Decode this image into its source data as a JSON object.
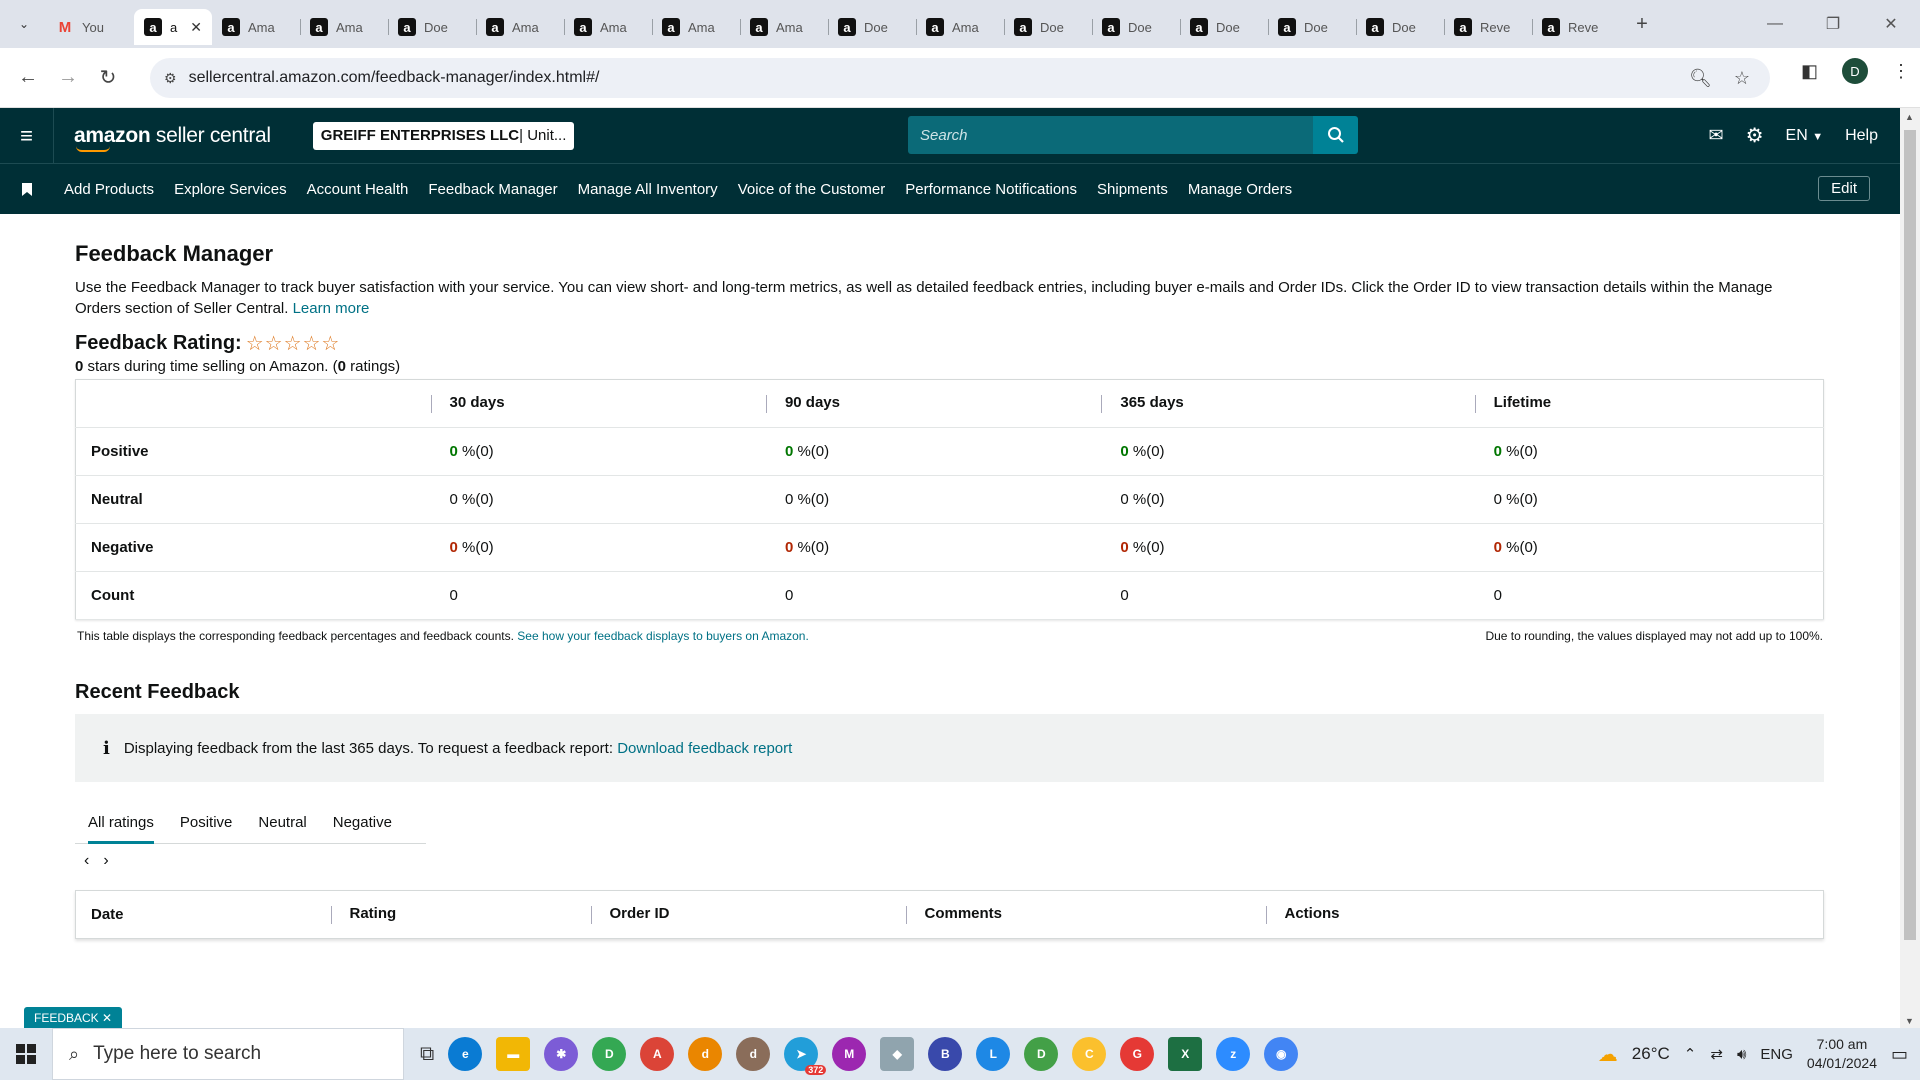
{
  "browser": {
    "tabs": [
      {
        "label": "You",
        "icon": "gmail-icon"
      },
      {
        "label": "a",
        "icon": "amazon-icon",
        "active": true
      },
      {
        "label": "Ama",
        "icon": "amazon-icon"
      },
      {
        "label": "Ama",
        "icon": "amazon-icon"
      },
      {
        "label": "Doe",
        "icon": "amazon-icon"
      },
      {
        "label": "Ama",
        "icon": "amazon-icon"
      },
      {
        "label": "Ama",
        "icon": "amazon-icon"
      },
      {
        "label": "Ama",
        "icon": "amazon-icon"
      },
      {
        "label": "Ama",
        "icon": "amazon-icon"
      },
      {
        "label": "Doe",
        "icon": "amazon-icon"
      },
      {
        "label": "Ama",
        "icon": "amazon-icon"
      },
      {
        "label": "Doe",
        "icon": "amazon-icon"
      },
      {
        "label": "Doe",
        "icon": "amazon-icon"
      },
      {
        "label": "Doe",
        "icon": "amazon-icon"
      },
      {
        "label": "Doe",
        "icon": "amazon-icon"
      },
      {
        "label": "Doe",
        "icon": "amazon-icon"
      },
      {
        "label": "Reve",
        "icon": "amazon-icon"
      },
      {
        "label": "Reve",
        "icon": "amazon-icon"
      }
    ],
    "url": "sellercentral.amazon.com/feedback-manager/index.html#/",
    "profile_initial": "D"
  },
  "header": {
    "logo_bold": "amazon",
    "logo_rest": " seller central",
    "account_name": "GREIFF ENTERPRISES LLC",
    "account_market": " | Unit...",
    "search_placeholder": "Search",
    "language": "EN",
    "help": "Help"
  },
  "nav": {
    "items": [
      "Add Products",
      "Explore Services",
      "Account Health",
      "Feedback Manager",
      "Manage All Inventory",
      "Voice of the Customer",
      "Performance Notifications",
      "Shipments",
      "Manage Orders"
    ],
    "edit": "Edit"
  },
  "page": {
    "title": "Feedback Manager",
    "description": "Use the Feedback Manager to track buyer satisfaction with your service. You can view short- and long-term metrics, as well as detailed feedback entries, including buyer e-mails and Order IDs. Click the Order ID to view transaction details within the Manage Orders section of Seller Central.",
    "learn_more": "Learn more",
    "rating_label": "Feedback Rating:",
    "stars": "☆☆☆☆☆",
    "rating_stars_value": "0",
    "rating_mid": " stars during time selling on Amazon. (",
    "rating_count": "0",
    "rating_end": " ratings)"
  },
  "summary_table": {
    "columns": [
      "30 days",
      "90 days",
      "365 days",
      "Lifetime"
    ],
    "rows": [
      {
        "label": "Positive",
        "cells": [
          {
            "v": "0",
            "s": " %(0)"
          },
          {
            "v": "0",
            "s": " %(0)"
          },
          {
            "v": "0",
            "s": " %(0)"
          },
          {
            "v": "0",
            "s": " %(0)"
          }
        ],
        "tone": "g"
      },
      {
        "label": "Neutral",
        "cells": [
          {
            "v": "0",
            "s": " %(0)"
          },
          {
            "v": "0",
            "s": " %(0)"
          },
          {
            "v": "0",
            "s": " %(0)"
          },
          {
            "v": "0",
            "s": " %(0)"
          }
        ],
        "tone": "n"
      },
      {
        "label": "Negative",
        "cells": [
          {
            "v": "0",
            "s": " %(0)"
          },
          {
            "v": "0",
            "s": " %(0)"
          },
          {
            "v": "0",
            "s": " %(0)"
          },
          {
            "v": "0",
            "s": " %(0)"
          }
        ],
        "tone": "r"
      },
      {
        "label": "Count",
        "cells": [
          {
            "v": "",
            "s": "0"
          },
          {
            "v": "",
            "s": "0"
          },
          {
            "v": "",
            "s": "0"
          },
          {
            "v": "",
            "s": "0"
          }
        ],
        "tone": "n"
      }
    ],
    "note_left": "This table displays the corresponding feedback percentages and feedback counts.",
    "note_link": "See how your feedback displays to buyers on Amazon.",
    "note_right": "Due to rounding, the values displayed may not add up to 100%."
  },
  "recent": {
    "title": "Recent Feedback",
    "info": "Displaying feedback from the last 365 days. To request a feedback report:",
    "info_link": "Download feedback report",
    "tabs": [
      "All ratings",
      "Positive",
      "Neutral",
      "Negative"
    ],
    "columns": [
      "Date",
      "Rating",
      "Order ID",
      "Comments",
      "Actions"
    ]
  },
  "feedback_chip": "FEEDBACK",
  "taskbar": {
    "search_placeholder": "Type here to search",
    "temperature": "26°C",
    "language": "ENG",
    "time": "7:00 am",
    "date": "04/01/2024",
    "badge": "372"
  },
  "colors": {
    "header_bg": "#002f36",
    "accent": "#008296",
    "link": "#007185",
    "positive": "#007600",
    "negative": "#b12704"
  }
}
